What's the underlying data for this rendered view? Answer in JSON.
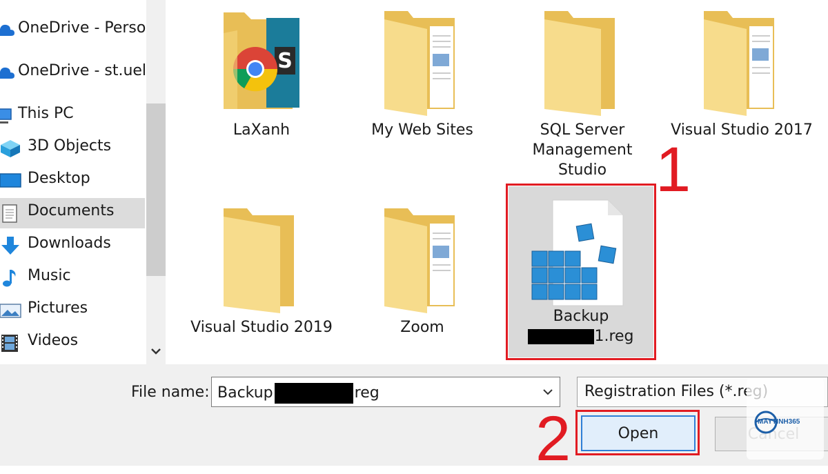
{
  "sidebar": {
    "items": [
      {
        "label": "OneDrive - Persor",
        "icon": "onedrive-cloud-icon"
      },
      {
        "label": "OneDrive - st.uel.e",
        "icon": "onedrive-cloud-icon"
      },
      {
        "label": "This PC",
        "icon": "computer-icon"
      },
      {
        "label": "3D Objects",
        "icon": "3d-objects-icon"
      },
      {
        "label": "Desktop",
        "icon": "desktop-icon"
      },
      {
        "label": "Documents",
        "icon": "documents-icon",
        "selected": true
      },
      {
        "label": "Downloads",
        "icon": "download-arrow-icon"
      },
      {
        "label": "Music",
        "icon": "music-note-icon"
      },
      {
        "label": "Pictures",
        "icon": "pictures-icon"
      },
      {
        "label": "Videos",
        "icon": "videos-film-icon"
      }
    ]
  },
  "files": [
    {
      "name": "LaXanh",
      "type": "folder",
      "icon": "folder-with-chrome-icon"
    },
    {
      "name": "My Web Sites",
      "type": "folder",
      "icon": "folder-with-documents-icon"
    },
    {
      "name": "SQL Server Management Studio",
      "type": "folder",
      "icon": "folder-icon"
    },
    {
      "name": "Visual Studio 2017",
      "type": "folder",
      "icon": "folder-with-documents-icon"
    },
    {
      "name": "Visual Studio 2019",
      "type": "folder",
      "icon": "folder-icon"
    },
    {
      "name": "Zoom",
      "type": "folder",
      "icon": "folder-with-documents-icon"
    },
    {
      "name_line1": "Backup",
      "name_line2_suffix": "1.reg",
      "type": "registry-file",
      "icon": "registry-file-icon",
      "selected": true
    }
  ],
  "annotations": {
    "step1": "1",
    "step2": "2",
    "highlight_color": "#e11b22"
  },
  "bottom": {
    "filename_label": "File name:",
    "filename_prefix": "Backup",
    "filename_suffix": "reg",
    "filetype": "Registration Files (*.reg)",
    "open_label": "Open",
    "cancel_label": "Cancel"
  },
  "watermark": {
    "brand": "MAYTINH365"
  },
  "colors": {
    "folder": "#f5d77e",
    "selection": "#d9d9d9",
    "accent": "#2f7fd6"
  }
}
